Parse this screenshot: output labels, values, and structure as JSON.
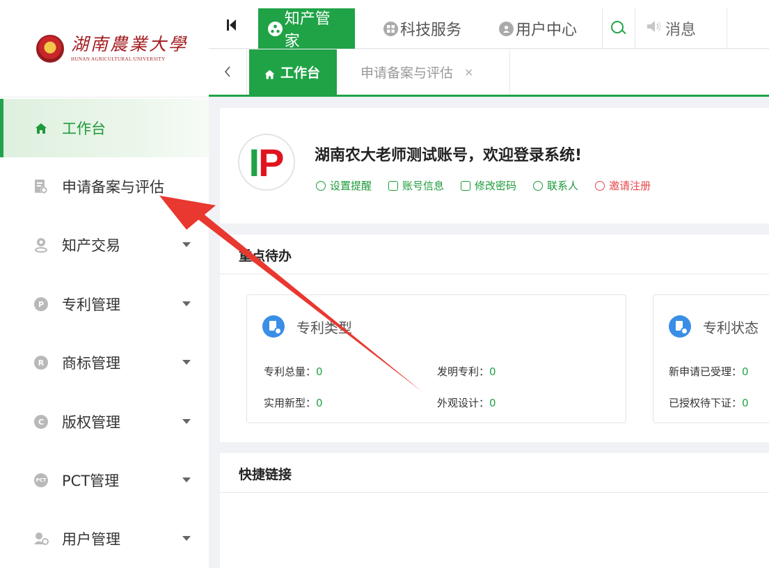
{
  "sidebar": {
    "logo": {
      "name_cn": "湖南農業大學",
      "name_en": "HUNAN AGRICULTURAL UNIVERSITY"
    },
    "items": [
      {
        "label": "工作台",
        "icon": "home-icon",
        "active": true
      },
      {
        "label": "申请备案与评估",
        "icon": "document-icon"
      },
      {
        "label": "知产交易",
        "icon": "user-pin-icon",
        "expandable": true
      },
      {
        "label": "专利管理",
        "icon": "p-circle-icon",
        "badge": "P",
        "expandable": true
      },
      {
        "label": "商标管理",
        "icon": "r-circle-icon",
        "badge": "R",
        "expandable": true
      },
      {
        "label": "版权管理",
        "icon": "c-circle-icon",
        "badge": "C",
        "expandable": true
      },
      {
        "label": "PCT管理",
        "icon": "pct-circle-icon",
        "badge": "PCT",
        "expandable": true
      },
      {
        "label": "用户管理",
        "icon": "users-icon",
        "expandable": true
      }
    ]
  },
  "topbar": {
    "tabs": [
      {
        "label": "知产管家",
        "icon": "network-icon",
        "active": true
      },
      {
        "label": "科技服务",
        "icon": "grid-icon"
      },
      {
        "label": "用户中心",
        "icon": "user-icon"
      }
    ],
    "search_icon": "search-icon",
    "message_label": "消息"
  },
  "pagetabs": {
    "tabs": [
      {
        "label": "工作台",
        "icon": "home-icon",
        "active": true
      },
      {
        "label": "申请备案与评估",
        "closable": true,
        "close_glyph": "×"
      }
    ]
  },
  "welcome": {
    "avatar_letters": {
      "first": "I",
      "second": "P"
    },
    "title": "湖南农大老师测试账号，欢迎登录系统!",
    "links": [
      {
        "label": "设置提醒",
        "icon": "settings-icon"
      },
      {
        "label": "账号信息",
        "icon": "account-info-icon"
      },
      {
        "label": "修改密码",
        "icon": "edit-icon"
      },
      {
        "label": "联系人",
        "icon": "contacts-icon"
      },
      {
        "label": "邀请注册",
        "icon": "invite-icon",
        "color": "#e6464b"
      }
    ]
  },
  "todo": {
    "title": "重点待办",
    "boxes": [
      {
        "title": "专利类型",
        "stats": [
          {
            "label": "专利总量：",
            "value": "0"
          },
          {
            "label": "发明专利：",
            "value": "0"
          },
          {
            "label": "实用新型：",
            "value": "0"
          },
          {
            "label": "外观设计：",
            "value": "0"
          }
        ]
      },
      {
        "title": "专利状态",
        "stats": [
          {
            "label": "新申请已受理：",
            "value": "0"
          },
          {
            "label": "已授权待下证：",
            "value": "0"
          }
        ]
      }
    ]
  },
  "quicklinks": {
    "title": "快捷链接"
  },
  "colors": {
    "brand_green": "#1fa346",
    "accent_red": "#e0141e",
    "annotation_arrow": "#e8382f"
  }
}
